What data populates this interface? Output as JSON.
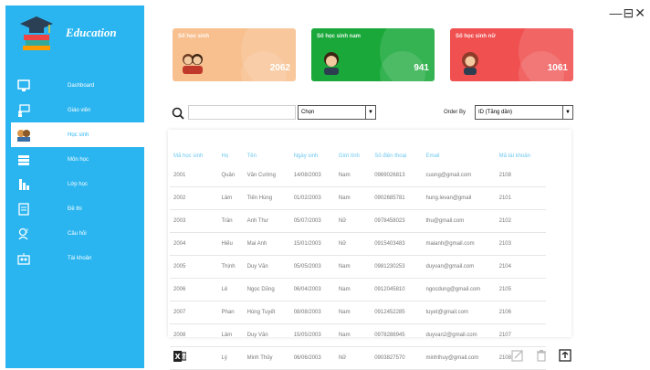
{
  "app": {
    "brand": "Education"
  },
  "window": {
    "controls": "—⊟✕"
  },
  "sidebar": {
    "items": [
      {
        "label": "Dashboard",
        "icon": "monitor-icon"
      },
      {
        "label": "Giáo viên",
        "icon": "teacher-icon"
      },
      {
        "label": "Học sinh",
        "icon": "students-icon",
        "active": true
      },
      {
        "label": "Môn học",
        "icon": "books-icon"
      },
      {
        "label": "Lớp học",
        "icon": "class-icon"
      },
      {
        "label": "Đề thi",
        "icon": "exam-icon"
      },
      {
        "label": "Câu hỏi",
        "icon": "question-icon"
      },
      {
        "label": "Tài khoản",
        "icon": "account-icon"
      }
    ]
  },
  "cards": [
    {
      "title": "Số học sinh",
      "value": "2062",
      "color": "#f8c08f"
    },
    {
      "title": "Số học sinh nam",
      "value": "941",
      "color": "#1aa83a"
    },
    {
      "title": "Số học sinh nữ",
      "value": "1061",
      "color": "#f05050"
    }
  ],
  "filters": {
    "search_value": "",
    "filter_select": "Chọn",
    "order_label": "Order By",
    "order_select": "ID (Tăng dần)"
  },
  "table": {
    "headers": [
      "Mã học sinh",
      "Họ",
      "Tên",
      "Ngày sinh",
      "Giới tính",
      "Số điện thoại",
      "Email",
      "Mã tài khoản"
    ],
    "rows": [
      [
        "2001",
        "Quân",
        "Văn Cường",
        "14/08/2003",
        "Nam",
        "0969026813",
        "cuong@gmail.com",
        "2108"
      ],
      [
        "2002",
        "Lâm",
        "Tiến Hùng",
        "01/02/2003",
        "Nam",
        "0902685781",
        "hung.levan@gmail",
        "2101"
      ],
      [
        "2003",
        "Trần",
        "Anh Thư",
        "05/07/2003",
        "Nữ",
        "0978458023",
        "thu@gmail.com",
        "2102"
      ],
      [
        "2004",
        "Hiếu",
        "Mai Anh",
        "15/01/2003",
        "Nữ",
        "0915403483",
        "maianh@gmail.com",
        "2103"
      ],
      [
        "2005",
        "Thịnh",
        "Duy Văn",
        "05/05/2003",
        "Nam",
        "0981230253",
        "duyvan@gmail.com",
        "2104"
      ],
      [
        "2006",
        "Lê",
        "Ngọc Dũng",
        "06/04/2003",
        "Nam",
        "0912045810",
        "ngocdung@gmail.com",
        "2105"
      ],
      [
        "2007",
        "Phan",
        "Hùng Tuyết",
        "08/08/2003",
        "Nam",
        "0912452285",
        "tuyet@gmail.com",
        "2106"
      ],
      [
        "2008",
        "Lâm",
        "Duy Văn",
        "15/05/2003",
        "Nam",
        "0978288945",
        "duyvan2@gmail.com",
        "2107"
      ],
      [
        "2009",
        "Lý",
        "Minh Thủy",
        "06/06/2003",
        "Nữ",
        "0903827570",
        "minhthuy@gmail.com",
        "2108"
      ]
    ]
  },
  "colors": {
    "sidebar": "#2ab5f0",
    "header_text": "#6ec8ef"
  }
}
